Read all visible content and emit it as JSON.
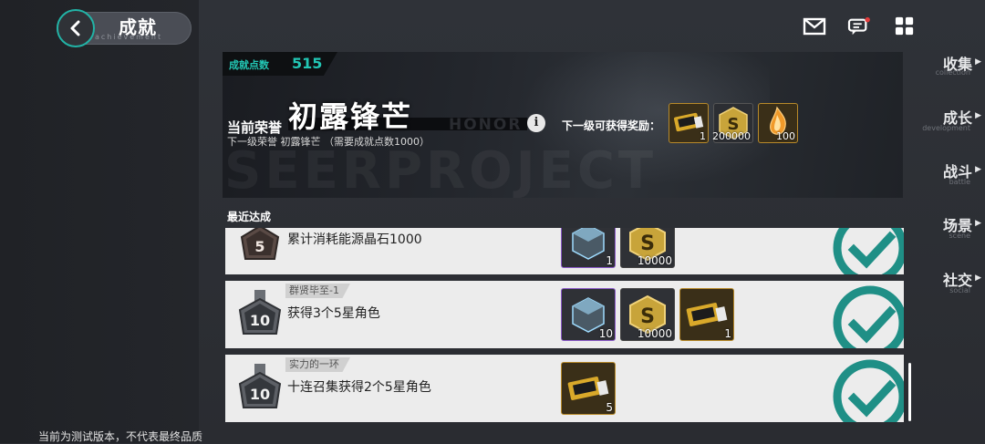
{
  "header": {
    "title": "成就",
    "subtitle": "achievement"
  },
  "sidebar": {
    "items": [
      {
        "label": "收集",
        "sub": "collection"
      },
      {
        "label": "成长",
        "sub": "development"
      },
      {
        "label": "战斗",
        "sub": "battle"
      },
      {
        "label": "场景",
        "sub": "scene"
      },
      {
        "label": "社交",
        "sub": "social"
      }
    ],
    "footer_note": "当前为测试版本，不代表最终品质"
  },
  "banner": {
    "points_label": "成就点数",
    "points_value": "515",
    "honor_label": "当前荣誉",
    "honor_name": "初露锋芒",
    "honor_en": "HONOR",
    "next_honor": "下一级荣誉 初露锋芒 （需要成就点数1000）",
    "reward_label": "下一级可获得奖励：",
    "rewards": [
      {
        "icon": "ticket-icon",
        "qty": "1"
      },
      {
        "icon": "coin-icon",
        "qty": "200000"
      },
      {
        "icon": "crystal-icon",
        "qty": "100"
      }
    ],
    "watermark": "SEERPROJECT"
  },
  "recent": {
    "title": "最近达成",
    "items": [
      {
        "tag": "",
        "title": "累计消耗能源晶石1000",
        "medal_level": "5",
        "rewards": [
          {
            "icon": "cube-icon",
            "qty": "1"
          },
          {
            "icon": "coin-icon",
            "qty": "10000"
          }
        ]
      },
      {
        "tag": "群贤毕至-1",
        "title": "获得3个5星角色",
        "medal_level": "10",
        "rewards": [
          {
            "icon": "cube-icon",
            "qty": "10"
          },
          {
            "icon": "coin-icon",
            "qty": "10000"
          },
          {
            "icon": "ticket-icon",
            "qty": "1"
          }
        ]
      },
      {
        "tag": "实力的一环",
        "title": "十连召集获得2个5星角色",
        "medal_level": "10",
        "rewards": [
          {
            "icon": "ticket-icon",
            "qty": "5"
          }
        ]
      }
    ]
  },
  "colors": {
    "accent": "#22c6b4",
    "check": "#1f8f86",
    "card_bg": "#ececec"
  }
}
